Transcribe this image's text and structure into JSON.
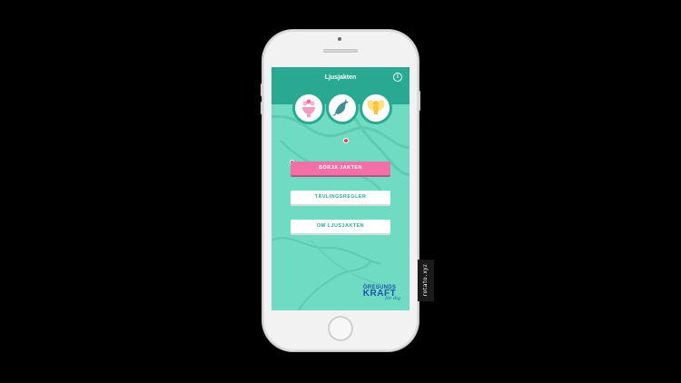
{
  "app": {
    "title": "Ljusjakten",
    "info_icon": "info-icon"
  },
  "badges": [
    {
      "icon": "flower-bowl-icon"
    },
    {
      "icon": "dolphin-icon"
    },
    {
      "icon": "fairy-icon"
    }
  ],
  "buttons": {
    "start": "BÖRJA JAKTEN",
    "rules": "TÄVLINGSREGLER",
    "about": "OM LJUSJAKTEN"
  },
  "brand": {
    "line1": "ÖRESUNDS",
    "line2": "KRAFT",
    "tagline": "för dig"
  },
  "watermark": "rotato.xyz",
  "colors": {
    "teal": "#2aa992",
    "mint": "#6fdbc3",
    "pink": "#f26fa8",
    "brand_blue": "#1f57a6"
  }
}
